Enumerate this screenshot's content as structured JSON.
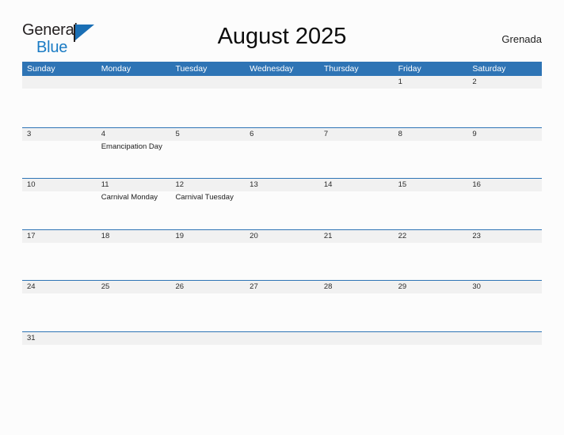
{
  "brand": {
    "name_part1": "General",
    "name_part2": "Blue",
    "flag_icon": "triangle-flag-icon"
  },
  "header": {
    "title": "August 2025",
    "country": "Grenada"
  },
  "colors": {
    "header_blue": "#2e74b5",
    "logo_blue": "#1a7bc4",
    "daynum_band": "#f1f1f1",
    "page_background": "#fcfcfc"
  },
  "weekdays": [
    "Sunday",
    "Monday",
    "Tuesday",
    "Wednesday",
    "Thursday",
    "Friday",
    "Saturday"
  ],
  "weeks": [
    {
      "days": [
        {
          "num": "",
          "event": ""
        },
        {
          "num": "",
          "event": ""
        },
        {
          "num": "",
          "event": ""
        },
        {
          "num": "",
          "event": ""
        },
        {
          "num": "",
          "event": ""
        },
        {
          "num": "1",
          "event": ""
        },
        {
          "num": "2",
          "event": ""
        }
      ]
    },
    {
      "days": [
        {
          "num": "3",
          "event": ""
        },
        {
          "num": "4",
          "event": "Emancipation Day"
        },
        {
          "num": "5",
          "event": ""
        },
        {
          "num": "6",
          "event": ""
        },
        {
          "num": "7",
          "event": ""
        },
        {
          "num": "8",
          "event": ""
        },
        {
          "num": "9",
          "event": ""
        }
      ]
    },
    {
      "days": [
        {
          "num": "10",
          "event": ""
        },
        {
          "num": "11",
          "event": "Carnival Monday"
        },
        {
          "num": "12",
          "event": "Carnival Tuesday"
        },
        {
          "num": "13",
          "event": ""
        },
        {
          "num": "14",
          "event": ""
        },
        {
          "num": "15",
          "event": ""
        },
        {
          "num": "16",
          "event": ""
        }
      ]
    },
    {
      "days": [
        {
          "num": "17",
          "event": ""
        },
        {
          "num": "18",
          "event": ""
        },
        {
          "num": "19",
          "event": ""
        },
        {
          "num": "20",
          "event": ""
        },
        {
          "num": "21",
          "event": ""
        },
        {
          "num": "22",
          "event": ""
        },
        {
          "num": "23",
          "event": ""
        }
      ]
    },
    {
      "days": [
        {
          "num": "24",
          "event": ""
        },
        {
          "num": "25",
          "event": ""
        },
        {
          "num": "26",
          "event": ""
        },
        {
          "num": "27",
          "event": ""
        },
        {
          "num": "28",
          "event": ""
        },
        {
          "num": "29",
          "event": ""
        },
        {
          "num": "30",
          "event": ""
        }
      ]
    },
    {
      "short": true,
      "days": [
        {
          "num": "31",
          "event": ""
        },
        {
          "num": "",
          "event": ""
        },
        {
          "num": "",
          "event": ""
        },
        {
          "num": "",
          "event": ""
        },
        {
          "num": "",
          "event": ""
        },
        {
          "num": "",
          "event": ""
        },
        {
          "num": "",
          "event": ""
        }
      ]
    }
  ]
}
